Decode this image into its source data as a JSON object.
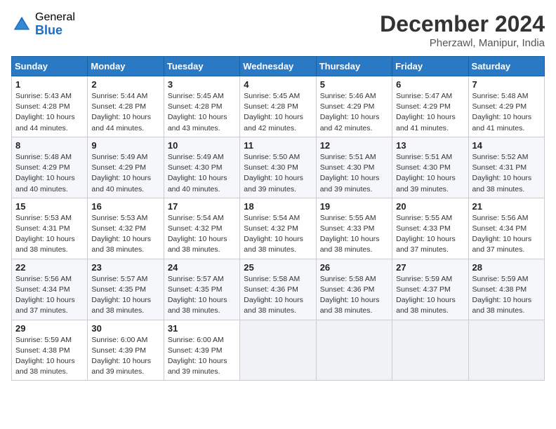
{
  "header": {
    "logo_general": "General",
    "logo_blue": "Blue",
    "month_title": "December 2024",
    "location": "Pherzawl, Manipur, India"
  },
  "weekdays": [
    "Sunday",
    "Monday",
    "Tuesday",
    "Wednesday",
    "Thursday",
    "Friday",
    "Saturday"
  ],
  "weeks": [
    [
      {
        "day": "1",
        "sunrise": "5:43 AM",
        "sunset": "4:28 PM",
        "daylight": "10 hours and 44 minutes."
      },
      {
        "day": "2",
        "sunrise": "5:44 AM",
        "sunset": "4:28 PM",
        "daylight": "10 hours and 44 minutes."
      },
      {
        "day": "3",
        "sunrise": "5:45 AM",
        "sunset": "4:28 PM",
        "daylight": "10 hours and 43 minutes."
      },
      {
        "day": "4",
        "sunrise": "5:45 AM",
        "sunset": "4:28 PM",
        "daylight": "10 hours and 42 minutes."
      },
      {
        "day": "5",
        "sunrise": "5:46 AM",
        "sunset": "4:29 PM",
        "daylight": "10 hours and 42 minutes."
      },
      {
        "day": "6",
        "sunrise": "5:47 AM",
        "sunset": "4:29 PM",
        "daylight": "10 hours and 41 minutes."
      },
      {
        "day": "7",
        "sunrise": "5:48 AM",
        "sunset": "4:29 PM",
        "daylight": "10 hours and 41 minutes."
      }
    ],
    [
      {
        "day": "8",
        "sunrise": "5:48 AM",
        "sunset": "4:29 PM",
        "daylight": "10 hours and 40 minutes."
      },
      {
        "day": "9",
        "sunrise": "5:49 AM",
        "sunset": "4:29 PM",
        "daylight": "10 hours and 40 minutes."
      },
      {
        "day": "10",
        "sunrise": "5:49 AM",
        "sunset": "4:30 PM",
        "daylight": "10 hours and 40 minutes."
      },
      {
        "day": "11",
        "sunrise": "5:50 AM",
        "sunset": "4:30 PM",
        "daylight": "10 hours and 39 minutes."
      },
      {
        "day": "12",
        "sunrise": "5:51 AM",
        "sunset": "4:30 PM",
        "daylight": "10 hours and 39 minutes."
      },
      {
        "day": "13",
        "sunrise": "5:51 AM",
        "sunset": "4:30 PM",
        "daylight": "10 hours and 39 minutes."
      },
      {
        "day": "14",
        "sunrise": "5:52 AM",
        "sunset": "4:31 PM",
        "daylight": "10 hours and 38 minutes."
      }
    ],
    [
      {
        "day": "15",
        "sunrise": "5:53 AM",
        "sunset": "4:31 PM",
        "daylight": "10 hours and 38 minutes."
      },
      {
        "day": "16",
        "sunrise": "5:53 AM",
        "sunset": "4:32 PM",
        "daylight": "10 hours and 38 minutes."
      },
      {
        "day": "17",
        "sunrise": "5:54 AM",
        "sunset": "4:32 PM",
        "daylight": "10 hours and 38 minutes."
      },
      {
        "day": "18",
        "sunrise": "5:54 AM",
        "sunset": "4:32 PM",
        "daylight": "10 hours and 38 minutes."
      },
      {
        "day": "19",
        "sunrise": "5:55 AM",
        "sunset": "4:33 PM",
        "daylight": "10 hours and 38 minutes."
      },
      {
        "day": "20",
        "sunrise": "5:55 AM",
        "sunset": "4:33 PM",
        "daylight": "10 hours and 37 minutes."
      },
      {
        "day": "21",
        "sunrise": "5:56 AM",
        "sunset": "4:34 PM",
        "daylight": "10 hours and 37 minutes."
      }
    ],
    [
      {
        "day": "22",
        "sunrise": "5:56 AM",
        "sunset": "4:34 PM",
        "daylight": "10 hours and 37 minutes."
      },
      {
        "day": "23",
        "sunrise": "5:57 AM",
        "sunset": "4:35 PM",
        "daylight": "10 hours and 38 minutes."
      },
      {
        "day": "24",
        "sunrise": "5:57 AM",
        "sunset": "4:35 PM",
        "daylight": "10 hours and 38 minutes."
      },
      {
        "day": "25",
        "sunrise": "5:58 AM",
        "sunset": "4:36 PM",
        "daylight": "10 hours and 38 minutes."
      },
      {
        "day": "26",
        "sunrise": "5:58 AM",
        "sunset": "4:36 PM",
        "daylight": "10 hours and 38 minutes."
      },
      {
        "day": "27",
        "sunrise": "5:59 AM",
        "sunset": "4:37 PM",
        "daylight": "10 hours and 38 minutes."
      },
      {
        "day": "28",
        "sunrise": "5:59 AM",
        "sunset": "4:38 PM",
        "daylight": "10 hours and 38 minutes."
      }
    ],
    [
      {
        "day": "29",
        "sunrise": "5:59 AM",
        "sunset": "4:38 PM",
        "daylight": "10 hours and 38 minutes."
      },
      {
        "day": "30",
        "sunrise": "6:00 AM",
        "sunset": "4:39 PM",
        "daylight": "10 hours and 39 minutes."
      },
      {
        "day": "31",
        "sunrise": "6:00 AM",
        "sunset": "4:39 PM",
        "daylight": "10 hours and 39 minutes."
      },
      null,
      null,
      null,
      null
    ]
  ],
  "labels": {
    "sunrise": "Sunrise:",
    "sunset": "Sunset:",
    "daylight": "Daylight:"
  }
}
